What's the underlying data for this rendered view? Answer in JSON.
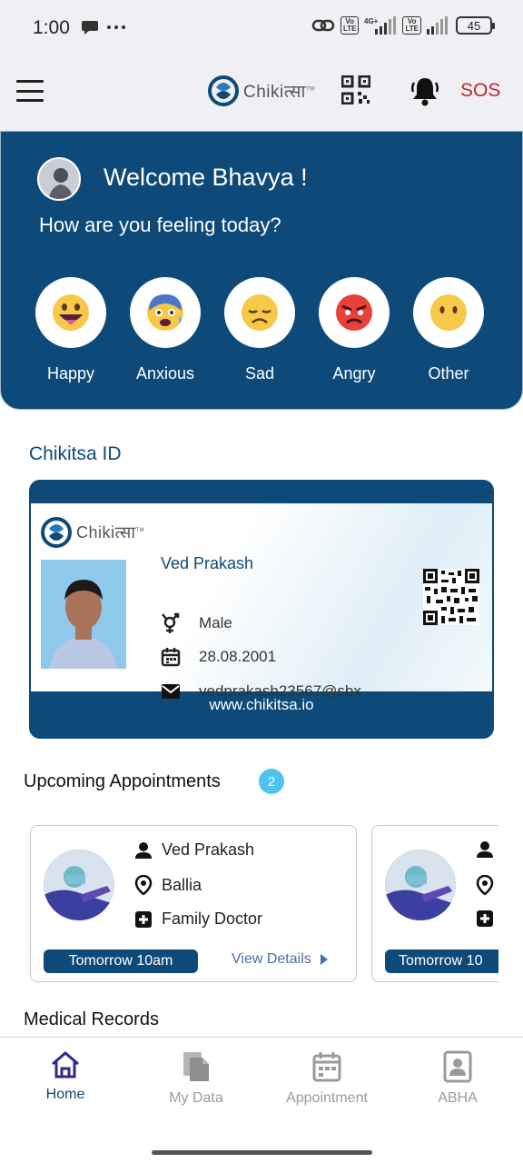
{
  "status_bar": {
    "time": "1:00",
    "battery": "45"
  },
  "header": {
    "brand": "Chiki",
    "brand_hindi": "त्सा",
    "sos": "SOS"
  },
  "welcome": {
    "title": "Welcome Bhavya !",
    "question": "How are you feeling today?",
    "moods": [
      {
        "label": "Happy",
        "emoji": "😝"
      },
      {
        "label": "Anxious",
        "emoji": "😰"
      },
      {
        "label": "Sad",
        "emoji": "😞"
      },
      {
        "label": "Angry",
        "emoji": "😡"
      },
      {
        "label": "Other",
        "emoji": "😶"
      }
    ]
  },
  "chikitsa_id": {
    "section_title": "Chikitsa ID",
    "name": "Ved Prakash",
    "gender": "Male",
    "dob": "28.08.2001",
    "email": "vedprakash23567@sbx",
    "website": "www.chikitsa.io"
  },
  "appointments": {
    "title": "Upcoming Appointments",
    "count": "2",
    "items": [
      {
        "name": "Ved Prakash",
        "location": "Ballia",
        "specialty": "Family Doctor",
        "when": "Tomorrow  10am",
        "action": "View Details"
      },
      {
        "name": "",
        "location": "",
        "specialty": "",
        "when": "Tomorrow  10",
        "action": ""
      }
    ]
  },
  "medical_records": {
    "title": "Medical Records"
  },
  "bottom_nav": [
    {
      "label": "Home",
      "icon": "home-icon"
    },
    {
      "label": "My Data",
      "icon": "document-icon"
    },
    {
      "label": "Appointment",
      "icon": "calendar-icon"
    },
    {
      "label": "ABHA",
      "icon": "id-badge-icon"
    }
  ],
  "colors": {
    "primary": "#0d4a79",
    "sos": "#c0262d",
    "badge": "#4ec3ef"
  }
}
